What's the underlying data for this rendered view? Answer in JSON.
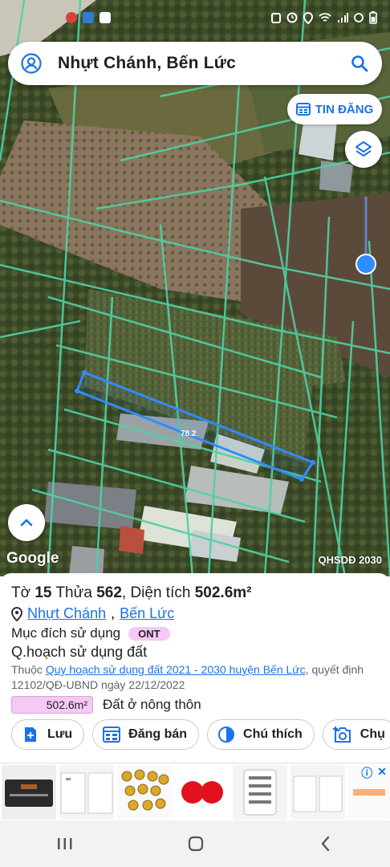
{
  "statusbar": {
    "left_icons": [
      "app-notification-icon",
      "tv-icon",
      "message-icon"
    ],
    "right_icons": [
      "alarm-icon",
      "clock-icon",
      "location-icon",
      "wifi-icon",
      "signal-icon",
      "lte-icon",
      "battery-icon"
    ]
  },
  "search": {
    "query": "Nhựt Chánh, Bến Lức"
  },
  "map": {
    "tin_dang_label": "TIN ĐĂNG",
    "google_label": "Google",
    "overlay_label": "QHSDĐ 2030",
    "measure_label": "78.2",
    "colors": {
      "parcel_line": "#4fd1a5",
      "selection": "#2f8cff"
    }
  },
  "parcel": {
    "to_label": "Tờ",
    "to_value": "15",
    "thua_label": "Thửa",
    "thua_value": "562",
    "area_label": ", Diện tích",
    "area_value": "502.6m²",
    "commune": "Nhựt Chánh",
    "district": "Bến Lức",
    "purpose_label": "Mục đích sử dụng",
    "purpose_code": "ONT",
    "plan_title": "Q.hoạch sử dụng đất",
    "plan_desc_prefix": "Thuộc",
    "plan_link": "Quy hoạch sử dụng đất 2021 - 2030 huyện Bến Lức",
    "plan_desc_suffix": ", quyết định 12102/QĐ-UBND ngày 22/12/2022",
    "plan_area": "502.6m²",
    "plan_area_label": "Đất ở nông thôn"
  },
  "actions": {
    "save": "Lưu",
    "post": "Đăng bán",
    "legend": "Chú thích",
    "capture": "Chụ"
  },
  "ads": {
    "info_icon": "ⓘ",
    "close_icon": "✕"
  }
}
